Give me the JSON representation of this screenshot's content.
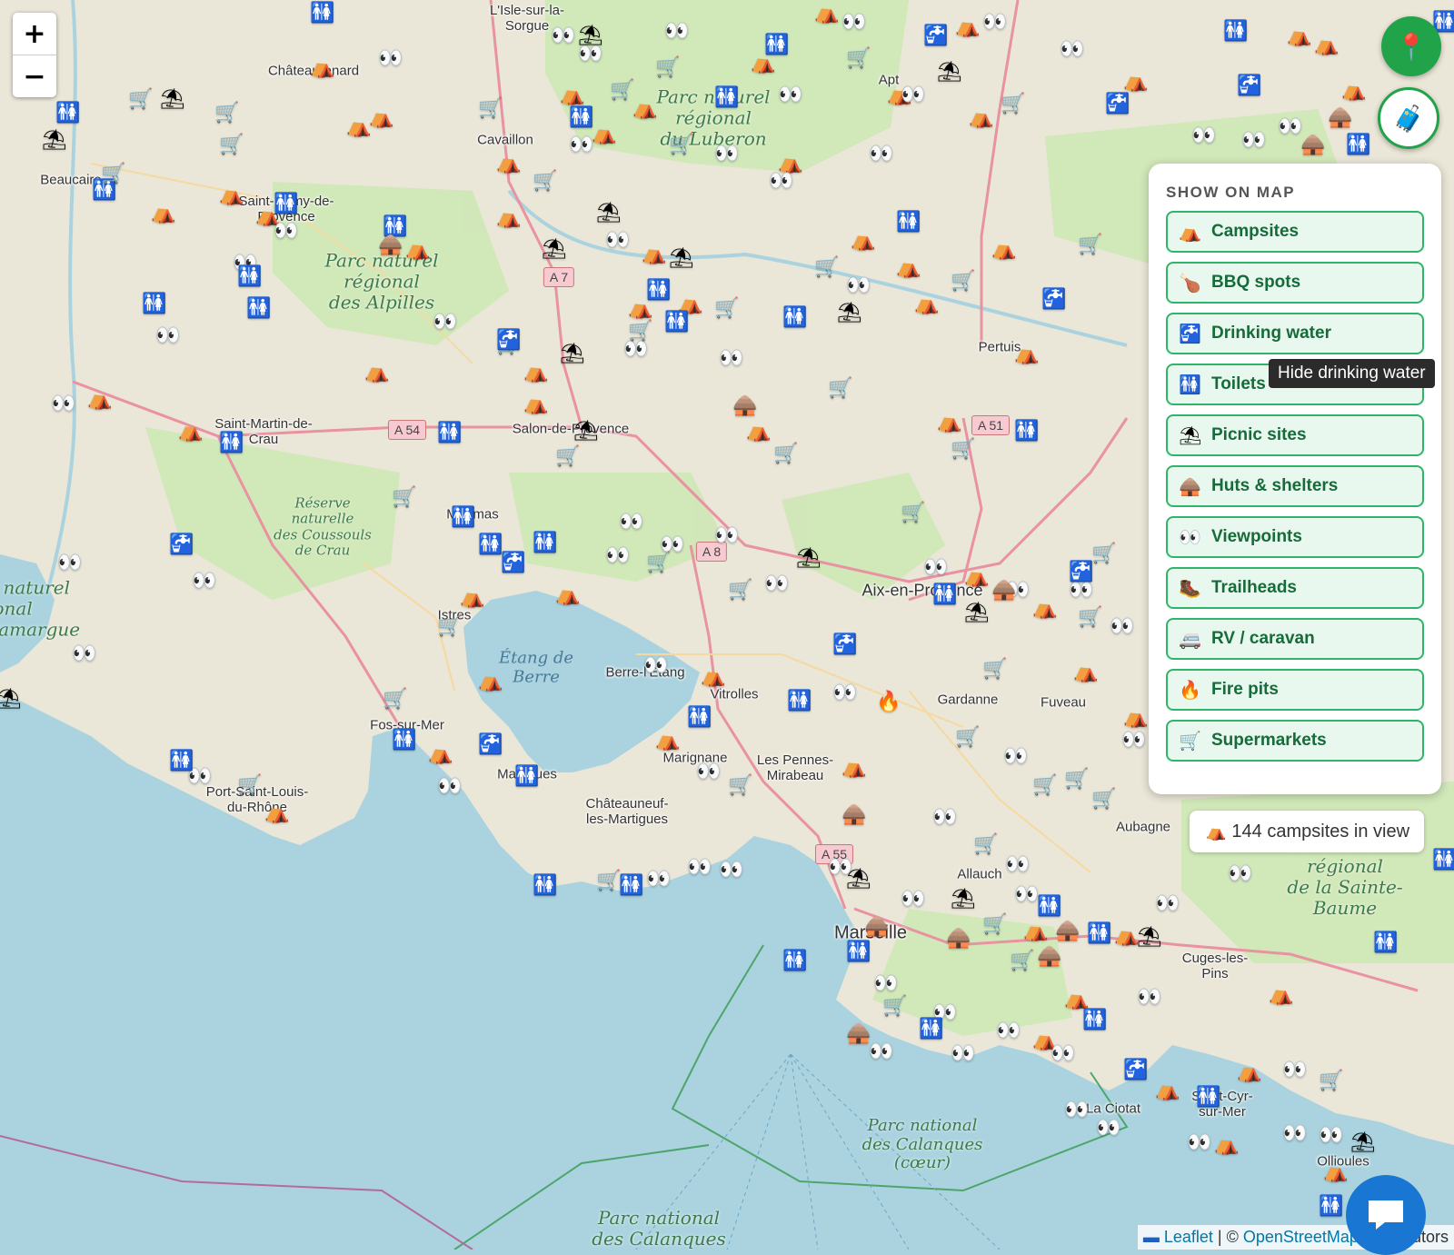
{
  "zoom": {
    "in_label": "+",
    "out_label": "−"
  },
  "panel": {
    "title": "SHOW ON MAP",
    "toggles": [
      {
        "icon": "⛺",
        "label": "Campsites"
      },
      {
        "icon": "🍗",
        "label": "BBQ spots"
      },
      {
        "icon": "🚰",
        "label": "Drinking water"
      },
      {
        "icon": "🚻",
        "label": "Toilets"
      },
      {
        "icon": "⛱",
        "label": "Picnic sites"
      },
      {
        "icon": "🛖",
        "label": "Huts & shelters"
      },
      {
        "icon": "👀",
        "label": "Viewpoints"
      },
      {
        "icon": "🥾",
        "label": "Trailheads"
      },
      {
        "icon": "🚐",
        "label": "RV / caravan"
      },
      {
        "icon": "🔥",
        "label": "Fire pits"
      },
      {
        "icon": "🛒",
        "label": "Supermarkets"
      }
    ]
  },
  "tooltip": "Hide drinking water",
  "count_badge": {
    "icon": "⛺",
    "text": "144 campsites in view"
  },
  "attribution": {
    "flag": "▬",
    "leaflet": "Leaflet",
    "sep": " | © ",
    "osm": "OpenStreetMap",
    "tail": " contributors"
  },
  "places": [
    "Châteaurenard",
    "Cavaillon",
    "Beaucaire",
    "Saint-Rémy-de-Provence",
    "Apt",
    "Pertuis",
    "Saint-Martin-de-Crau",
    "Salon-de-Provence",
    "Miramas",
    "Istres",
    "Berre-l'Étang",
    "Vitrolles",
    "Marignane",
    "Les Pennes-Mirabeau",
    "Aix-en-Provence",
    "Gardanne",
    "Fuveau",
    "Fos-sur-Mer",
    "Martigues",
    "Châteauneuf-les-Martigues",
    "Port-Saint-Louis-du-Rhône",
    "Allauch",
    "Marseille",
    "Aubagne",
    "Cuges-les-Pins",
    "La Ciotat",
    "Saint-Cyr-sur-Mer",
    "Ollioules",
    "L'Isle-sur-la-Sorgue"
  ],
  "parks": [
    "Parc naturel\nrégional\ndu Luberon",
    "Parc naturel\nrégional\ndes Alpilles",
    "Réserve\nnaturelle\ndes Coussouls\nde Crau",
    "Parc naturel\nrégional\nde la Sainte-\nBaume",
    "Parc national\ndes Calanques\n(cœur)",
    "Parc national\ndes Calanques",
    "Parc naturel\nrégional\nde Camargue"
  ],
  "water": [
    "Étang de\nBerre"
  ],
  "roads": [
    "A 7",
    "A 54",
    "A 8",
    "A 51",
    "A 55"
  ]
}
